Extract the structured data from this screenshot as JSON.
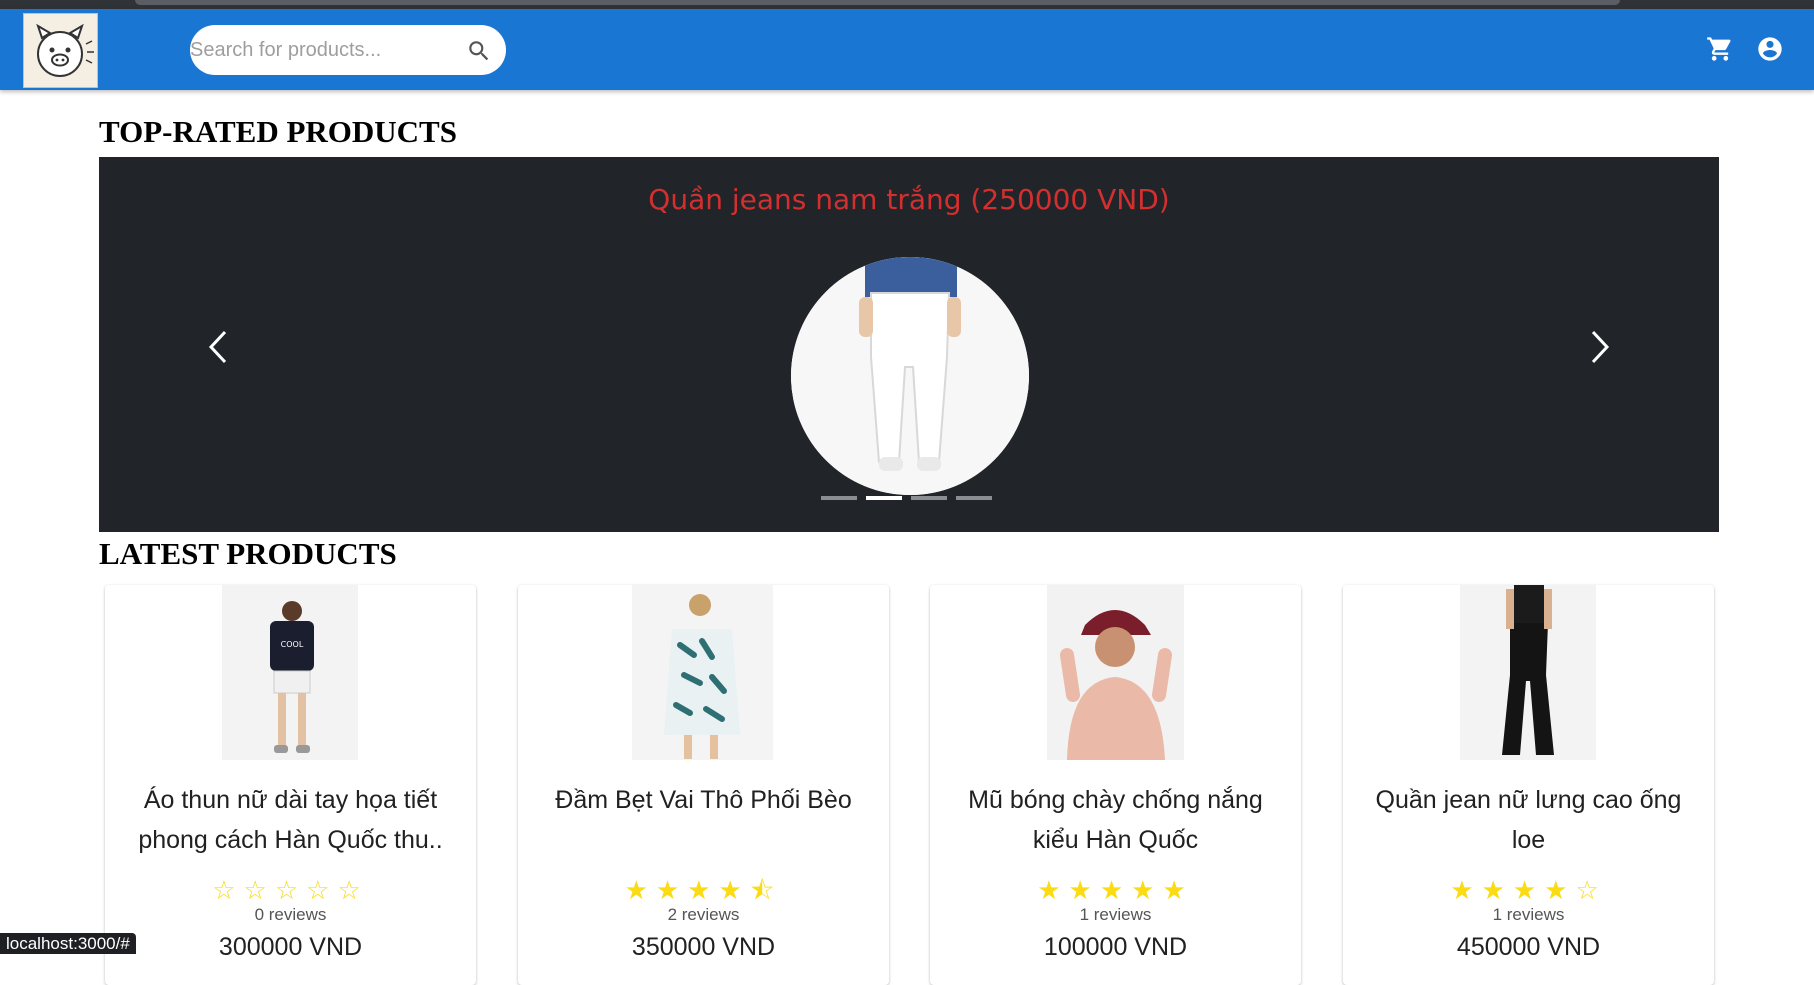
{
  "header": {
    "search_placeholder": "Search for products...",
    "brand_color": "#1976d2",
    "icons": [
      "search-icon",
      "shopping-cart-icon",
      "account-circle-icon"
    ]
  },
  "top_rated": {
    "title": "TOP-RATED PRODUCTS",
    "carousel": {
      "caption": "Quần jeans nam trắng (250000 VND)",
      "slide_count": 4,
      "active_index": 1
    }
  },
  "latest": {
    "title": "LATEST PRODUCTS",
    "products": [
      {
        "name": "Áo thun nữ dài tay họa tiết phong cách Hàn Quốc thu..",
        "rating": 0,
        "stars": "☆☆☆☆☆",
        "reviews": "0 reviews",
        "price": "300000 VND"
      },
      {
        "name": "Đầm Bẹt Vai Thô Phối Bèo",
        "rating": 4.5,
        "stars": "★★★★⯪",
        "reviews": "2 reviews",
        "price": "350000 VND"
      },
      {
        "name": "Mũ bóng chày chống nắng kiểu Hàn Quốc",
        "rating": 5,
        "stars": "★★★★★",
        "reviews": "1 reviews",
        "price": "100000 VND"
      },
      {
        "name": "Quần jean nữ lưng cao ống loe",
        "rating": 4,
        "stars": "★★★★☆",
        "reviews": "1 reviews",
        "price": "450000 VND"
      }
    ]
  },
  "status_bar": {
    "url": "localhost:3000/#"
  }
}
